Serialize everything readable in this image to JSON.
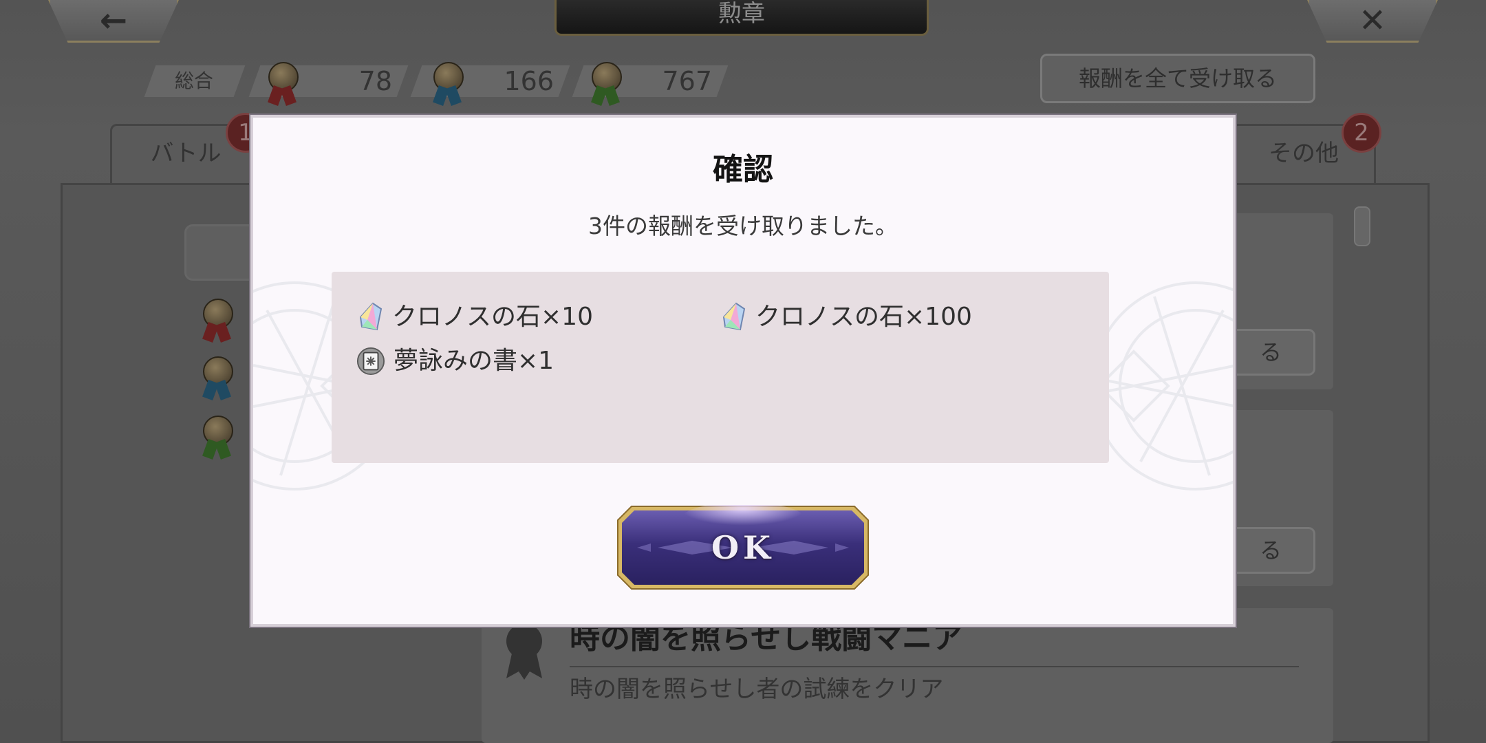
{
  "header": {
    "title": "勲章",
    "back_icon": "arrow-left-icon",
    "back_glyph": "←",
    "close_icon": "close-icon",
    "close_glyph": "✕"
  },
  "stats": {
    "label": "総合",
    "gold_count": "78",
    "silver_count": "166",
    "bronze_count": "767"
  },
  "claim_all_label": "報酬を全て受け取る",
  "tabs": [
    {
      "label": "バトル",
      "badge": "1"
    },
    {
      "label": "その他",
      "badge": "2"
    }
  ],
  "background_rows": {
    "claim_button_fragment": "る",
    "medal_title": "時の闇を照らせし戦闘マニア",
    "medal_description": "時の闇を照らせし者の試練をクリア"
  },
  "dialog": {
    "title": "確認",
    "message": "3件の報酬を受け取りました。",
    "rewards": [
      {
        "icon": "chronos-stone-icon",
        "label": "クロノスの石×10"
      },
      {
        "icon": "chronos-stone-icon",
        "label": "クロノスの石×100"
      },
      {
        "icon": "dream-book-icon",
        "label": "夢詠みの書×1"
      }
    ],
    "ok_label": "OK"
  },
  "colors": {
    "dialog_bg": "#fbf8fc",
    "reward_box_bg": "#e7dee2",
    "ok_button_main": "#3b2f78",
    "ok_button_border": "#c9a64a",
    "badge_red": "#5a2222"
  }
}
